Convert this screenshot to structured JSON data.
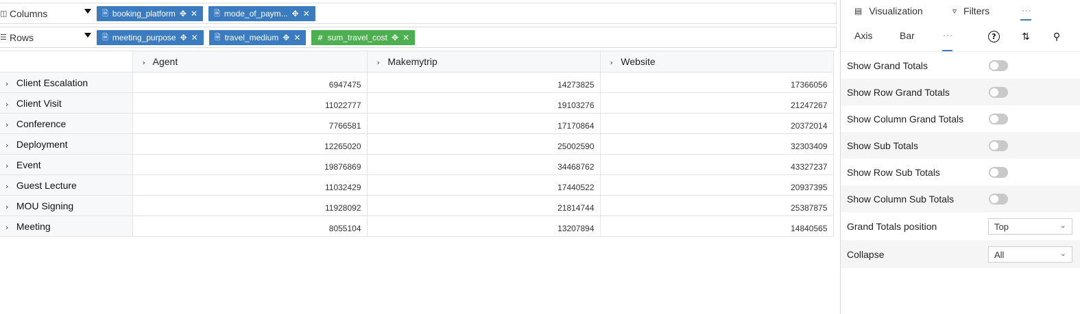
{
  "shelves": {
    "columns": {
      "label": "Columns",
      "icon": "columns-icon",
      "pills": [
        {
          "label": "booking_platform",
          "kind": "dimension"
        },
        {
          "label": "mode_of_paym...",
          "kind": "dimension"
        }
      ]
    },
    "rows": {
      "label": "Rows",
      "icon": "rows-icon",
      "pills": [
        {
          "label": "meeting_purpose",
          "kind": "dimension"
        },
        {
          "label": "travel_medium",
          "kind": "dimension"
        },
        {
          "label": "sum_travel_cost",
          "kind": "measure"
        }
      ]
    }
  },
  "pivot": {
    "columns": [
      "Agent",
      "Makemytrip",
      "Website"
    ],
    "rows": [
      {
        "label": "Client Escalation",
        "values": [
          "6947475",
          "14273825",
          "17366056"
        ]
      },
      {
        "label": "Client Visit",
        "values": [
          "11022777",
          "19103276",
          "21247267"
        ]
      },
      {
        "label": "Conference",
        "values": [
          "7766581",
          "17170864",
          "20372014"
        ]
      },
      {
        "label": "Deployment",
        "values": [
          "12265020",
          "25002590",
          "32303409"
        ]
      },
      {
        "label": "Event",
        "values": [
          "19876869",
          "34468762",
          "43327237"
        ]
      },
      {
        "label": "Guest Lecture",
        "values": [
          "11032429",
          "17440522",
          "20937395"
        ]
      },
      {
        "label": "MOU Signing",
        "values": [
          "11928092",
          "21814744",
          "25387875"
        ]
      },
      {
        "label": "Meeting",
        "values": [
          "8055104",
          "13207894",
          "14840565"
        ]
      }
    ]
  },
  "panel": {
    "tabs": {
      "visualization": "Visualization",
      "filters": "Filters",
      "more": "···"
    },
    "subtabs": {
      "axis": "Axis",
      "bar": "Bar",
      "more": "···"
    },
    "options": [
      {
        "label": "Show Grand Totals",
        "on": false
      },
      {
        "label": "Show Row Grand Totals",
        "on": false
      },
      {
        "label": "Show Column Grand Totals",
        "on": false
      },
      {
        "label": "Show Sub Totals",
        "on": false
      },
      {
        "label": "Show Row Sub Totals",
        "on": false
      },
      {
        "label": "Show Column Sub Totals",
        "on": false
      }
    ],
    "grand_totals_position": {
      "label": "Grand Totals position",
      "value": "Top"
    },
    "collapse": {
      "label": "Collapse",
      "value": "All"
    }
  },
  "colors": {
    "dimension_pill": "#3b7bbf",
    "measure_pill": "#4caf50",
    "accent": "#3b7bbf"
  }
}
